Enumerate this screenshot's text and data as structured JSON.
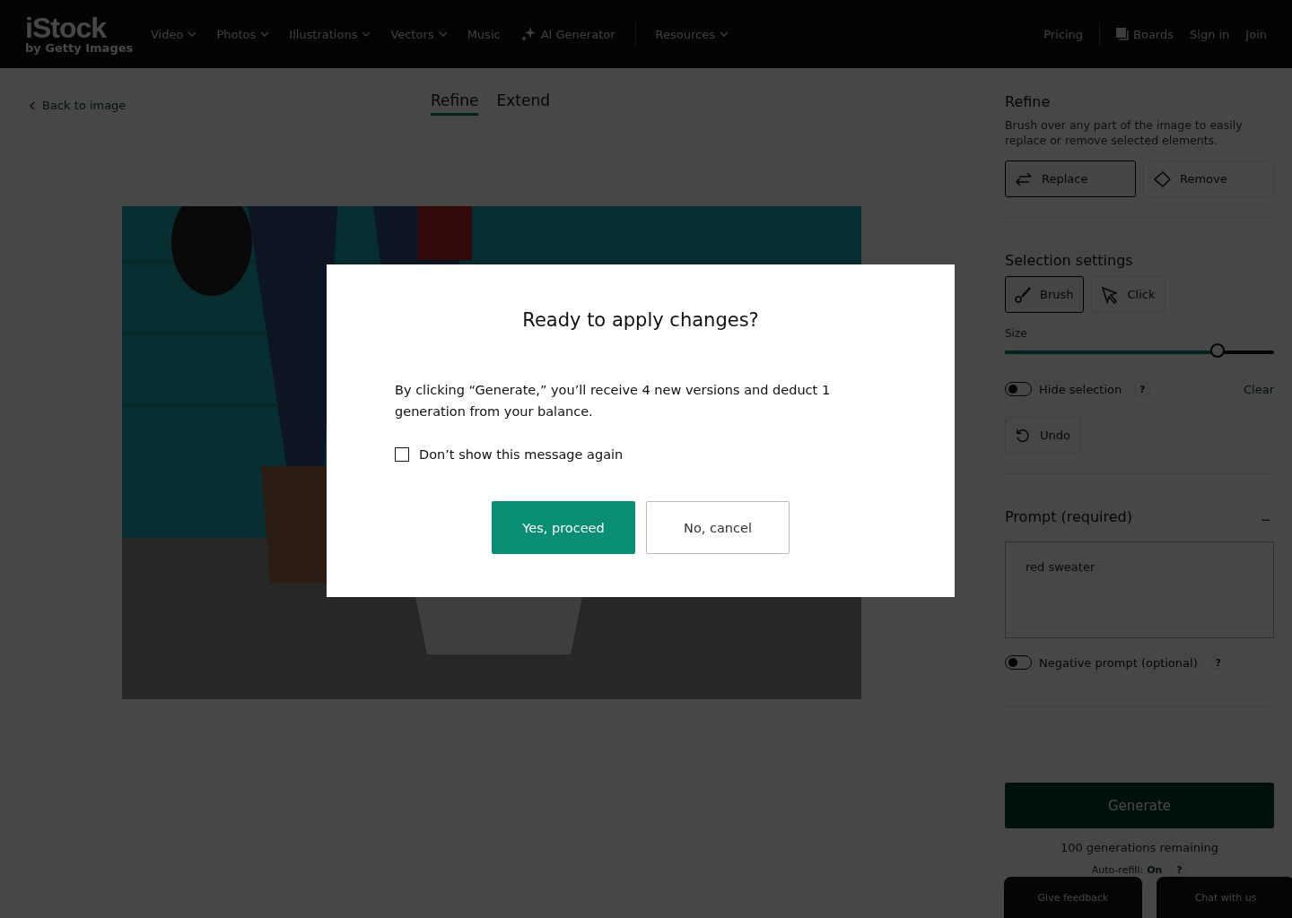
{
  "header": {
    "logo": "iStock",
    "logo_sub": "by Getty Images",
    "nav": [
      {
        "label": "Video",
        "kind": "dropdown"
      },
      {
        "label": "Photos",
        "kind": "dropdown"
      },
      {
        "label": "Illustrations",
        "kind": "dropdown"
      },
      {
        "label": "Vectors",
        "kind": "dropdown"
      },
      {
        "label": "Music",
        "kind": "plain"
      },
      {
        "label": "AI Generator",
        "kind": "sparkle"
      },
      {
        "label": "Resources",
        "kind": "dropdown"
      }
    ],
    "right_nav": [
      {
        "label": "Pricing",
        "kind": "plain"
      },
      {
        "label": "Boards",
        "kind": "boards"
      },
      {
        "label": "Sign in",
        "kind": "plain"
      },
      {
        "label": "Join",
        "kind": "plain"
      }
    ]
  },
  "back_link": "Back to image",
  "tabs": [
    {
      "label": "Refine",
      "selected": true
    },
    {
      "label": "Extend",
      "selected": false
    }
  ],
  "panel": {
    "title": "Refine",
    "description": "Brush over any part of the image to easily replace or remove selected elements.",
    "modes": [
      {
        "label": "Replace",
        "selected": true
      },
      {
        "label": "Remove",
        "selected": false
      }
    ],
    "selection_title": "Selection settings",
    "tools": [
      {
        "label": "Brush",
        "selected": true
      },
      {
        "label": "Click",
        "selected": false
      }
    ],
    "size_label": "Size",
    "size": {
      "level": 0.79
    },
    "hide_selection": {
      "label": "Hide selection",
      "help": "?",
      "on": false
    },
    "clear": "Clear",
    "undo": "Undo",
    "prompt_title": "Prompt (required)",
    "collapse": "−",
    "prompt": {
      "value": "red sweater"
    },
    "negative_prompt": {
      "label": "Negative prompt (optional)",
      "help": "?",
      "on": false
    },
    "generate": "Generate",
    "remaining": "100 generations remaining",
    "auto_refill_label": "Auto-refill:",
    "auto_refill_value": "On",
    "auto_refill_help": "?",
    "feedback": "Give feedback",
    "chat": "Chat with us"
  },
  "dialog": {
    "title": "Ready to apply changes?",
    "message": "By clicking “Generate,” you’ll receive 4 new versions and deduct 1 generation from your balance.",
    "checkbox": {
      "label": "Don’t show this message again",
      "checked": false
    },
    "confirm": "Yes, proceed",
    "cancel": "No, cancel"
  }
}
